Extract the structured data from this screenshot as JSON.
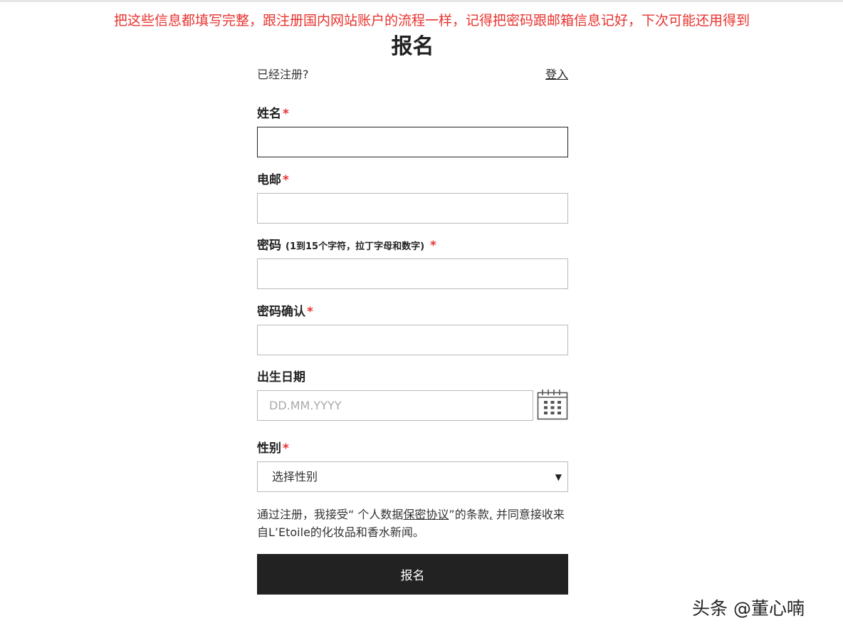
{
  "annotation": "把这些信息都填写完整，跟注册国内网站账户的流程一样，记得把密码跟邮箱信息记好，下次可能还用得到",
  "form": {
    "title": "报名",
    "already_registered": "已经注册?",
    "login_link": "登入",
    "fields": {
      "name": {
        "label": "姓名",
        "required_mark": "*",
        "value": ""
      },
      "email": {
        "label": "电邮",
        "required_mark": "*",
        "value": ""
      },
      "password": {
        "label": "密码",
        "hint": "(1到15个字符，拉丁字母和数字)",
        "required_mark": "*",
        "value": ""
      },
      "password_confirm": {
        "label": "密码确认",
        "required_mark": "*",
        "value": ""
      },
      "birthdate": {
        "label": "出生日期",
        "placeholder": "DD.MM.YYYY",
        "value": "",
        "icon": "calendar-icon"
      },
      "gender": {
        "label": "性别",
        "required_mark": "*",
        "selected": "选择性别",
        "icon": "dropdown-arrow-icon"
      }
    },
    "consent": {
      "prefix": "通过注册，我接受“ 个人数据",
      "link": "保密协议",
      "middle": "”的条款",
      "comma": ",",
      "suffix": "并同意接收来自L’Etoile的化妆品和香水新闻。"
    },
    "submit_label": "报名"
  },
  "watermark": "头条 @董心喃",
  "colors": {
    "annotation": "#e8332f",
    "required": "#e8332f",
    "button_bg": "#222222",
    "button_text": "#ffffff",
    "border": "#b9b9b9"
  }
}
